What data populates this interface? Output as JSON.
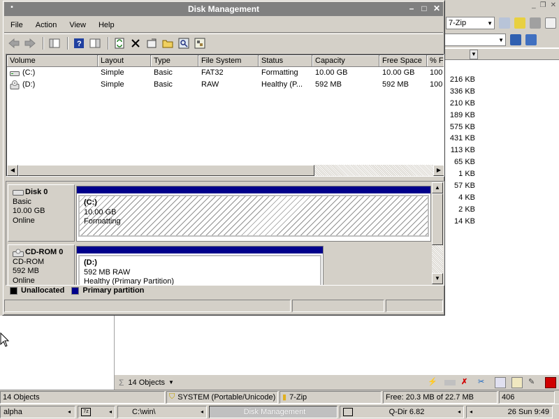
{
  "background": {
    "zip_combo": "7-Zip",
    "sizes": [
      "216 KB",
      "336 KB",
      "210 KB",
      "189 KB",
      "575 KB",
      "431 KB",
      "113 KB",
      "65 KB",
      "1 KB",
      "57 KB",
      "4 KB",
      "2 KB",
      "14 KB"
    ],
    "object_count": "14 Objects",
    "status": {
      "objects": "14 Objects",
      "system": "SYSTEM (Portable/Unicode)",
      "folder": "7-Zip",
      "free": "Free: 20.3 MB of 22.7 MB",
      "num": "406"
    },
    "taskbar": {
      "alpha": "alpha",
      "sevenz": "7z",
      "path": "C:\\win\\",
      "active": "Disk Management",
      "qdir": "Q-Dir 6.82",
      "clock": "26 Sun 9:49"
    }
  },
  "window": {
    "title": "Disk Management",
    "menu": [
      "File",
      "Action",
      "View",
      "Help"
    ]
  },
  "volume_list": {
    "columns": [
      "Volume",
      "Layout",
      "Type",
      "File System",
      "Status",
      "Capacity",
      "Free Space",
      "% Fr"
    ],
    "rows": [
      [
        "(C:)",
        "Simple",
        "Basic",
        "FAT32",
        "Formatting",
        "10.00 GB",
        "10.00 GB",
        "100 %"
      ],
      [
        "(D:)",
        "Simple",
        "Basic",
        "RAW",
        "Healthy (P...",
        "592 MB",
        "592 MB",
        "100 %"
      ]
    ]
  },
  "disks": [
    {
      "name": "Disk 0",
      "line2": "Basic",
      "line3": "10.00 GB",
      "line4": "Online",
      "partition": {
        "name": "(C:)",
        "line2": "10.00 GB",
        "line3": "Formatting"
      }
    },
    {
      "name": "CD-ROM 0",
      "line2": "CD-ROM",
      "line3": "592 MB",
      "line4": "Online",
      "partition": {
        "name": "(D:)",
        "line2": "592 MB RAW",
        "line3": "Healthy (Primary Partition)"
      }
    }
  ],
  "legend": {
    "unallocated": "Unallocated",
    "primary": "Primary partition",
    "unallocated_color": "#000000",
    "primary_color": "#00008b"
  }
}
